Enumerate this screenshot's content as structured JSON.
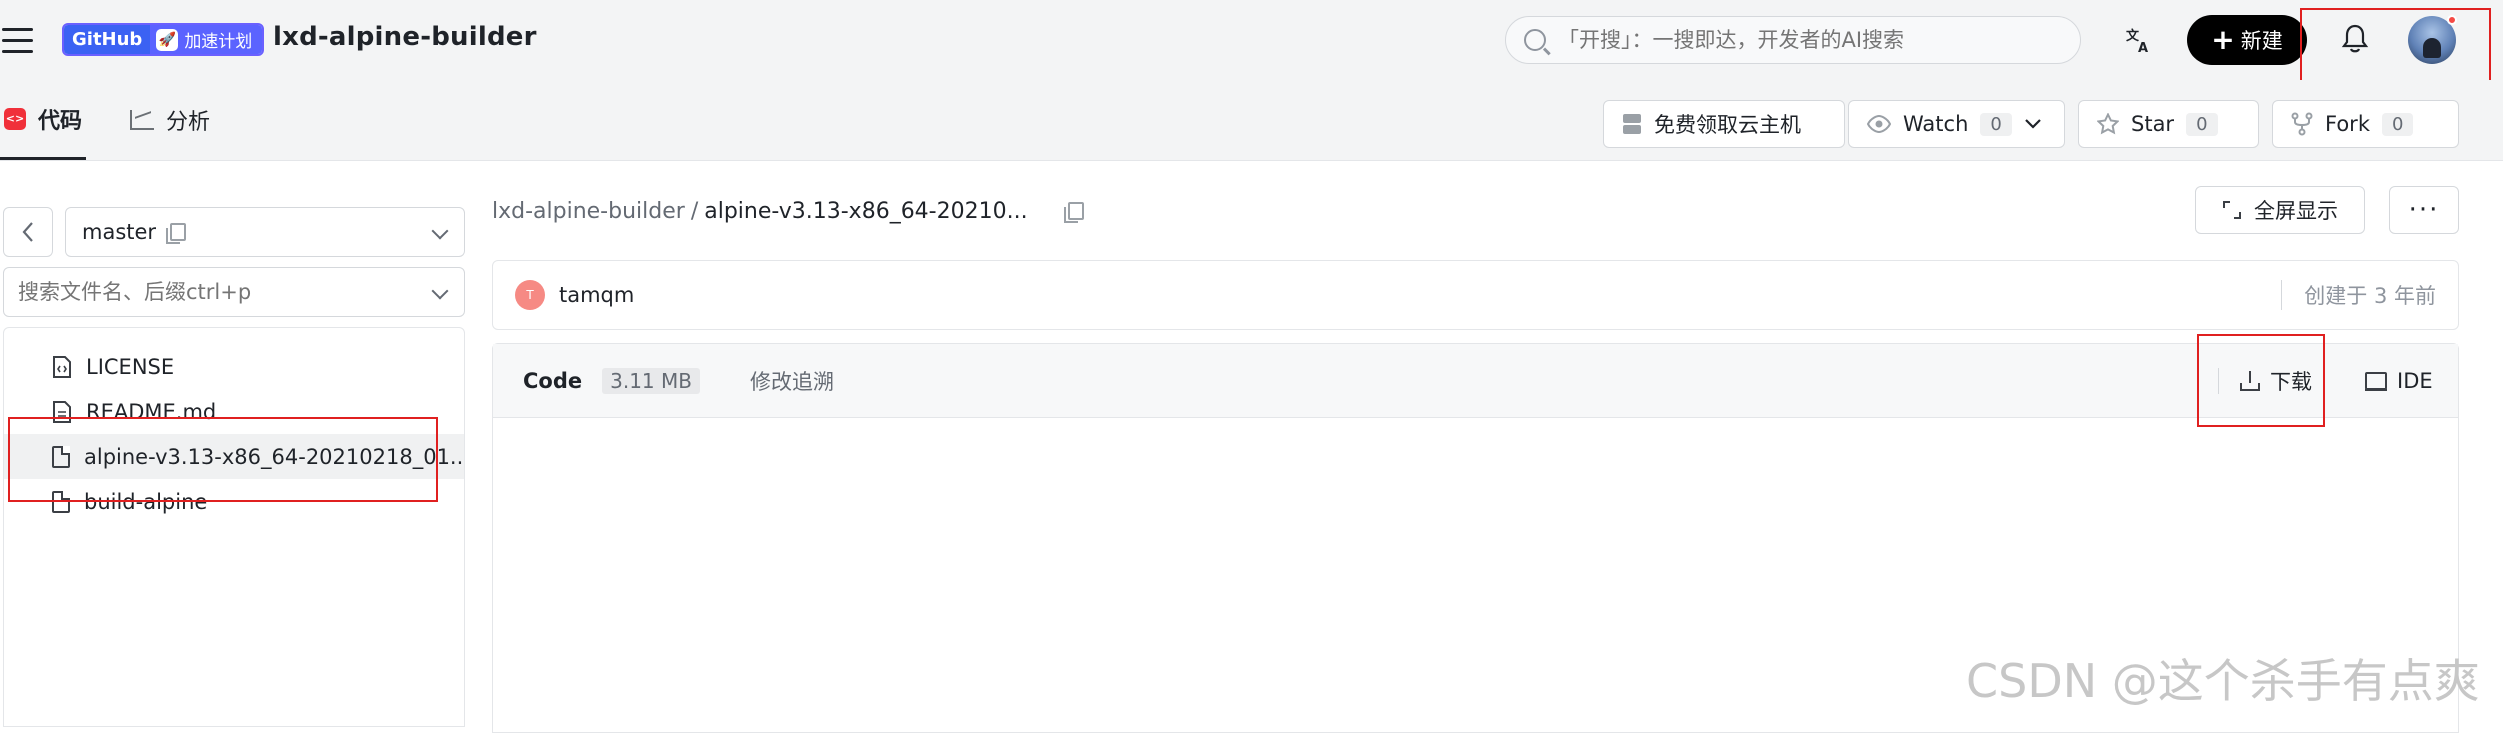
{
  "header": {
    "logo_left": "GitHub",
    "logo_right": "加速计划",
    "repo_title": "lxd-alpine-builder",
    "search_placeholder": "「开搜」：一搜即达，开发者的AI搜索",
    "new_button": "新建"
  },
  "subnav": {
    "tabs": [
      {
        "label": "代码"
      },
      {
        "label": "分析"
      }
    ],
    "cloud_button": "免费领取云主机",
    "watch": {
      "label": "Watch",
      "count": "0"
    },
    "star": {
      "label": "Star",
      "count": "0"
    },
    "fork": {
      "label": "Fork",
      "count": "0"
    }
  },
  "sidebar": {
    "branch": "master",
    "file_search_placeholder": "搜索文件名、后缀ctrl+p",
    "files": [
      {
        "name": "LICENSE"
      },
      {
        "name": "README.md"
      },
      {
        "name": "alpine-v3.13-x86_64-20210218_01..."
      },
      {
        "name": "build-alpine"
      }
    ]
  },
  "main": {
    "breadcrumb_repo": "lxd-alpine-builder",
    "breadcrumb_sep": "/",
    "breadcrumb_file": "alpine-v3.13-x86_64-20210...",
    "fullscreen_button": "全屏显示",
    "more_button": "···",
    "commit_avatar_letter": "T",
    "commit_author": "tamqm",
    "commit_time": "创建于 3 年前",
    "viewer_code_label": "Code",
    "viewer_size": "3.11 MB",
    "viewer_blame": "修改追溯",
    "download_button": "下载",
    "ide_button": "IDE"
  },
  "watermark": "CSDN @这个杀手有点爽"
}
